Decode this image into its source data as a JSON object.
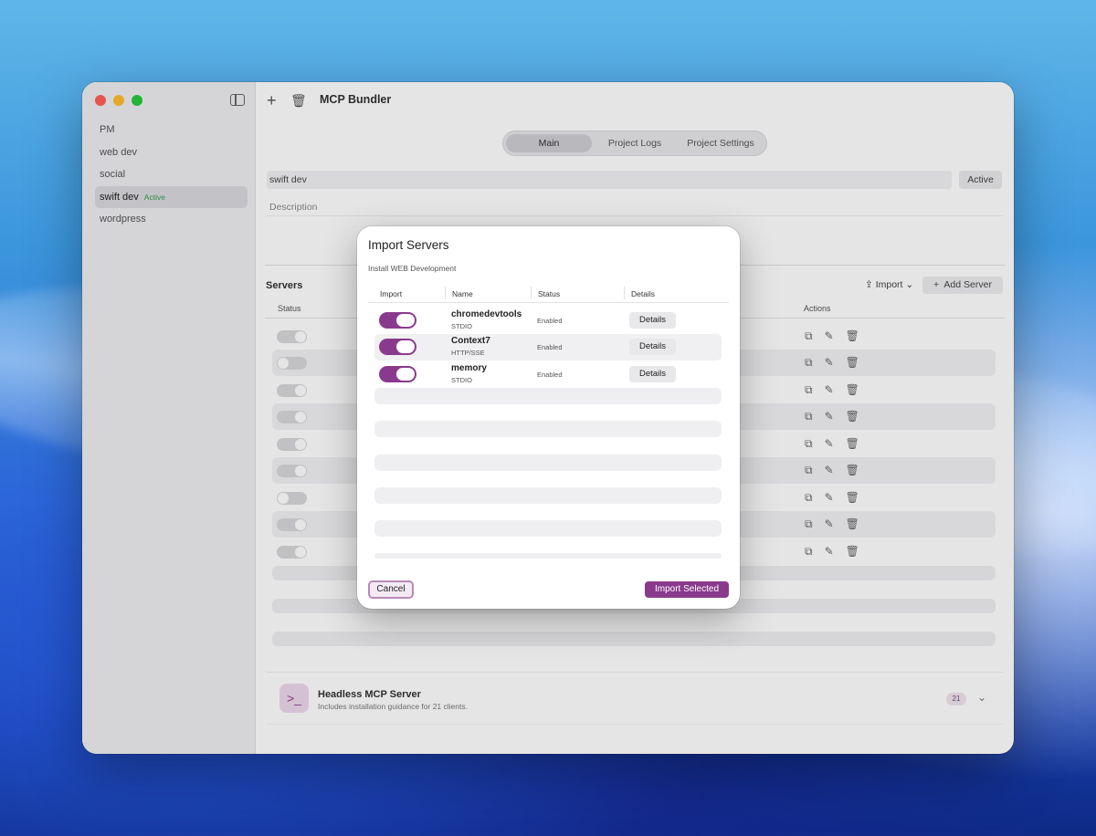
{
  "window": {
    "title": "MCP Bundler"
  },
  "sidebar": {
    "projects": [
      {
        "label": "PM",
        "badge": ""
      },
      {
        "label": "web dev",
        "badge": ""
      },
      {
        "label": "social",
        "badge": ""
      },
      {
        "label": "swift dev",
        "badge": "Active"
      },
      {
        "label": "wordpress",
        "badge": ""
      }
    ]
  },
  "tabs": [
    "Main",
    "Project Logs",
    "Project Settings"
  ],
  "project": {
    "name": "swift dev",
    "description_placeholder": "Description",
    "status_button": "Active"
  },
  "servers": {
    "title": "Servers",
    "import_label": "Import",
    "add_label": "Add Server",
    "columns": {
      "status": "Status",
      "actions": "Actions"
    }
  },
  "headless": {
    "title": "Headless MCP Server",
    "subtitle": "Includes installation guidance for 21 clients.",
    "count": "21"
  },
  "modal": {
    "title": "Import Servers",
    "subtitle": "Install WEB Development",
    "columns": [
      "Import",
      "Name",
      "Status",
      "Details"
    ],
    "rows": [
      {
        "name": "chromedevtools",
        "type": "STDIO",
        "status": "Enabled",
        "details": "Details",
        "checked": true
      },
      {
        "name": "Context7",
        "type": "HTTP/SSE",
        "status": "Enabled",
        "details": "Details",
        "checked": true
      },
      {
        "name": "memory",
        "type": "STDIO",
        "status": "Enabled",
        "details": "Details",
        "checked": true
      }
    ],
    "cancel": "Cancel",
    "import_selected": "Import Selected"
  },
  "colors": {
    "accent": "#8a3a8d",
    "active_badge": "#2e9d4a"
  }
}
